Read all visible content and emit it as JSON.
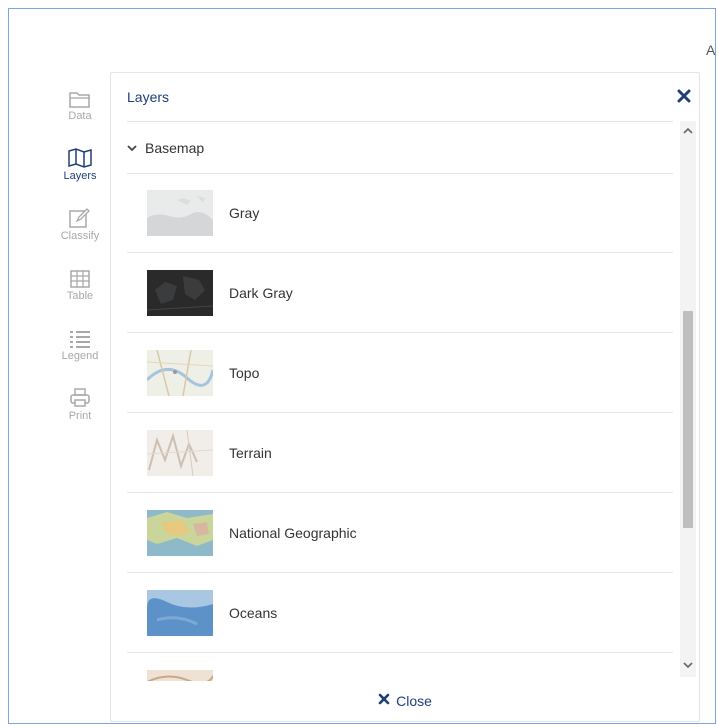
{
  "header_fragment": "A",
  "sidebar": {
    "items": [
      {
        "label": "Data",
        "icon": "folder-icon",
        "active": false
      },
      {
        "label": "Layers",
        "icon": "map-icon",
        "active": true
      },
      {
        "label": "Classify",
        "icon": "edit-icon",
        "active": false
      },
      {
        "label": "Table",
        "icon": "table-icon",
        "active": false
      },
      {
        "label": "Legend",
        "icon": "list-icon",
        "active": false
      },
      {
        "label": "Print",
        "icon": "printer-icon",
        "active": false
      }
    ]
  },
  "panel": {
    "title": "Layers",
    "group_label": "Basemap",
    "close_label": "Close",
    "basemaps": [
      {
        "name": "Gray"
      },
      {
        "name": "Dark Gray"
      },
      {
        "name": "Topo"
      },
      {
        "name": "Terrain"
      },
      {
        "name": "National Geographic"
      },
      {
        "name": "Oceans"
      }
    ]
  },
  "colors": {
    "accent": "#1f3f79",
    "inactive": "#a8a8a8",
    "frame_border": "#7aa7e4"
  }
}
